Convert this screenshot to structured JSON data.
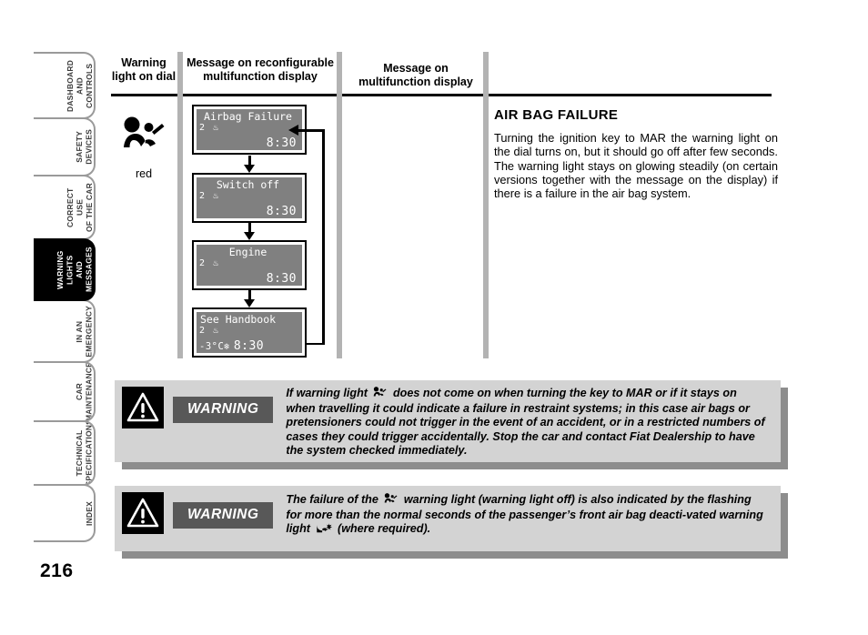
{
  "sidebar": {
    "tabs": [
      {
        "label": "DASHBOARD\nAND CONTROLS",
        "active": false
      },
      {
        "label": "SAFETY\nDEVICES",
        "active": false
      },
      {
        "label": "CORRECT USE\nOF THE CAR",
        "active": false
      },
      {
        "label": "WARNING\nLIGHTS AND\nMESSAGES",
        "active": true
      },
      {
        "label": "IN AN\nEMERGENCY",
        "active": false
      },
      {
        "label": "CAR\nMAINTENANCE",
        "active": false
      },
      {
        "label": "TECHNICAL\nSPECIFICATIONS",
        "active": false
      },
      {
        "label": "INDEX",
        "active": false
      }
    ]
  },
  "page_number": "216",
  "columns": {
    "warning_light": "Warning\nlight on dial",
    "reconfigurable": "Message on reconfigurable\nmultifunction display",
    "multifunction": "Message on\nmultifunction display"
  },
  "warning_light": {
    "icon": "airbag-warning-icon",
    "color_label": "red"
  },
  "lcd_flow": {
    "panels": [
      {
        "title": "Airbag Failure",
        "left": "2",
        "left_icon": "fuel-pump-icon",
        "temp": "",
        "clock": "8:30"
      },
      {
        "title": "Switch off",
        "left": "2",
        "left_icon": "fuel-pump-icon",
        "temp": "",
        "clock": "8:30"
      },
      {
        "title": "Engine",
        "left": "2",
        "left_icon": "fuel-pump-icon",
        "temp": "",
        "clock": "8:30"
      },
      {
        "title": "See Handbook",
        "left": "2",
        "left_icon": "fuel-pump-icon",
        "temp": "-3°C",
        "temp_icon": "snowflake-icon",
        "clock": "8:30"
      }
    ]
  },
  "detail": {
    "title": "AIR BAG FAILURE",
    "body": "Turning the ignition key to MAR the warning light on the dial turns on, but it should go off after few seconds. The warning light stays on glowing steadily (on certain versions together with the message on the display) if there is a failure in the air bag system."
  },
  "warnings": [
    {
      "badge": "WARNING",
      "icon": "warning-triangle-icon",
      "text_before": "If warning light ",
      "inline_icon": "airbag-warning-icon",
      "text_after": " does not come on when turning the key to MAR or if it stays on when travelling it could indicate a failure in restraint systems; in this case air bags or pretensioners could not trigger in the event of an accident, or in a restricted numbers of cases they could trigger accidentally. Stop the car and contact Fiat Dealership to have the system checked immediately."
    },
    {
      "badge": "WARNING",
      "icon": "warning-triangle-icon",
      "text_before": "The failure of the ",
      "inline_icon": "airbag-warning-icon",
      "text_mid": " warning light (warning light off) is also indicated by the flashing for more than the normal seconds of the passenger’s front air bag deacti-vated warning light ",
      "inline_icon_2": "passenger-airbag-off-icon",
      "text_after": " (where required)."
    }
  ],
  "colors": {
    "lcd_background": "#808080",
    "lcd_text": "#ffffff",
    "active_tab": "#000000",
    "warning_box": "#d3d3d3",
    "warning_badge": "#585858",
    "separator": "#b3b3b3"
  }
}
